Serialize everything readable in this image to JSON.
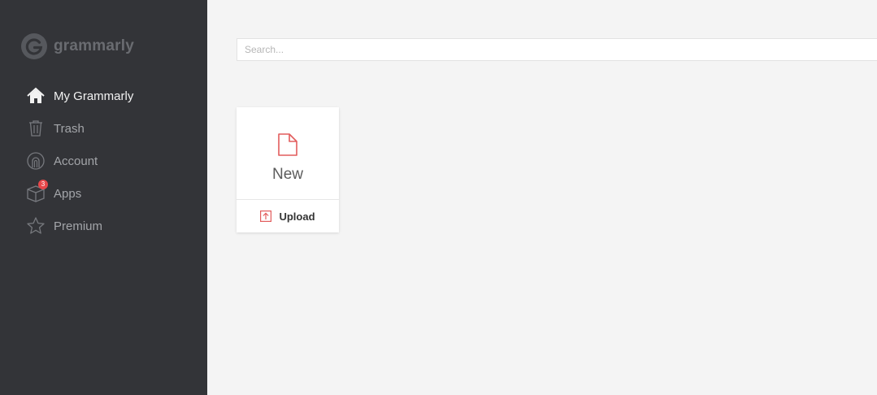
{
  "brand": {
    "name": "grammarly",
    "logo_icon": "grammarly-g-logo"
  },
  "sidebar": {
    "items": [
      {
        "label": "My Grammarly",
        "icon": "home-icon",
        "active": true
      },
      {
        "label": "Trash",
        "icon": "trash-icon",
        "active": false
      },
      {
        "label": "Account",
        "icon": "account-icon",
        "active": false
      },
      {
        "label": "Apps",
        "icon": "apps-box-icon",
        "active": false,
        "badge": "3"
      },
      {
        "label": "Premium",
        "icon": "star-icon",
        "active": false
      }
    ]
  },
  "search": {
    "placeholder": "Search..."
  },
  "new_card": {
    "new_label": "New",
    "new_icon": "document-icon",
    "upload_label": "Upload",
    "upload_icon": "upload-icon"
  },
  "colors": {
    "sidebar_bg": "#333438",
    "main_bg": "#f4f4f4",
    "accent_red": "#e25d5d",
    "badge_red": "#e8474a"
  }
}
